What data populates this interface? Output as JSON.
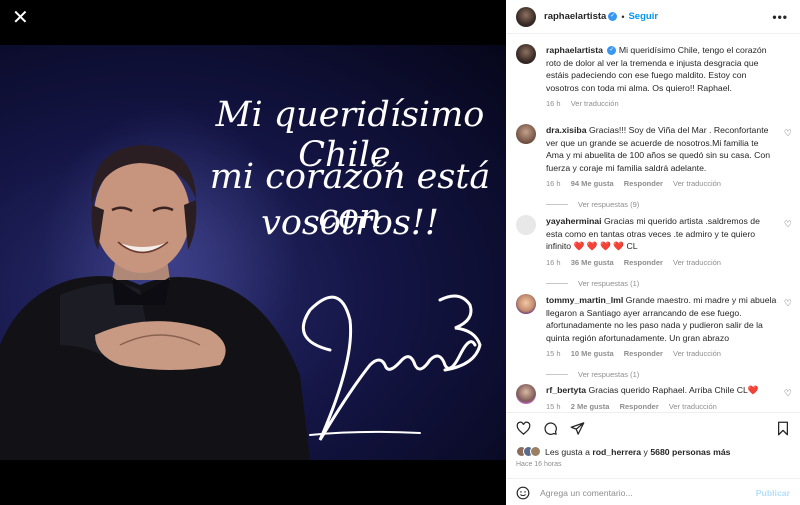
{
  "overlay": {
    "line1": "Mi queridísimo Chile,",
    "line2": "mi corazón está con",
    "line3": "vosotros!!",
    "signature": "Raphaël"
  },
  "close": "✕",
  "header": {
    "username": "raphaelartista",
    "separator": "•",
    "follow_label": "Seguir",
    "more": "•••"
  },
  "caption": {
    "username": "raphaelartista",
    "text": "Mi queridísimo Chile, tengo el corazón roto de dolor al ver la tremenda e injusta desgracia que estáis padeciendo con ese fuego maldito. Estoy con vosotros con toda mi alma. Os quiero!! Raphael.",
    "time": "16 h",
    "translate": "Ver traducción"
  },
  "comments": [
    {
      "username": "dra.xisiba",
      "text": "Gracias!!! Soy de Viña del Mar . Reconfortante ver que un grande se acuerde de nosotros.Mi familia te Ama y mi abuelita de 100 años se quedó sin su casa. Con fuerza y coraje mi familia saldrá adelante.",
      "time": "16 h",
      "likes": "94 Me gusta",
      "reply": "Responder",
      "translate": "Ver traducción",
      "replies": "Ver respuestas (9)"
    },
    {
      "username": "yayaherminai",
      "text": "Gracias mi querido artista .saldremos de esta como en tantas otras veces .te admiro y te quiero infinito ❤️ ❤️ ❤️ ❤️ CL",
      "time": "16 h",
      "likes": "36 Me gusta",
      "reply": "Responder",
      "translate": "Ver traducción",
      "replies": "Ver respuestas (1)"
    },
    {
      "username": "tommy_martin_lml",
      "text": "Grande maestro. mi madre y mi abuela llegaron a Santiago ayer arrancando de ese fuego. afortunadamente no les paso nada y pudieron salir de la quinta región afortunadamente. Un gran abrazo",
      "time": "15 h",
      "likes": "10 Me gusta",
      "reply": "Responder",
      "translate": "Ver traducción",
      "replies": "Ver respuestas (1)"
    },
    {
      "username": "rf_bertyta",
      "text": "Gracias querido Raphael. Arriba Chile CL❤️",
      "time": "15 h",
      "likes": "2 Me gusta",
      "reply": "Responder",
      "translate": "Ver traducción"
    }
  ],
  "likes": {
    "prefix": "Les gusta a",
    "user": "rod_herrera",
    "middle": "y",
    "count": "5680 personas más"
  },
  "time_ago": "Hace 16 horas",
  "add_comment": {
    "placeholder": "Agrega un comentario...",
    "publish": "Publicar"
  },
  "icons": {
    "like": "heart-icon",
    "comment": "comment-icon",
    "share": "share-icon",
    "save": "bookmark-icon",
    "emoji": "emoji-icon"
  }
}
